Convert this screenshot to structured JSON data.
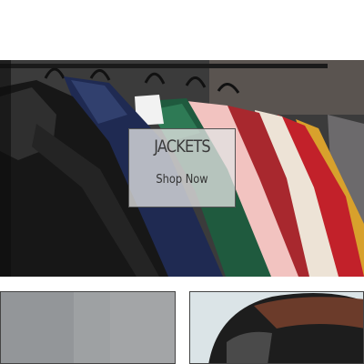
{
  "hero": {
    "title": "JACKETS",
    "cta_label": "Shop Now"
  }
}
